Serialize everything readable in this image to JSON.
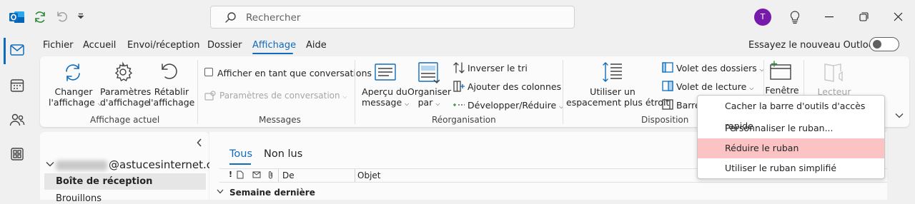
{
  "titlebar": {
    "search_placeholder": "Rechercher",
    "avatar_initial": "T"
  },
  "menu": {
    "tabs": [
      "Fichier",
      "Accueil",
      "Envoi/réception",
      "Dossier",
      "Affichage",
      "Aide"
    ],
    "active_tab": "Affichage",
    "new_outlook_label": "Essayez le nouveau Outlook"
  },
  "ribbon": {
    "affichage_actuel": {
      "group_label": "Affichage actuel",
      "changer": [
        "Changer",
        "l'affichage"
      ],
      "parametres": [
        "Paramètres",
        "d'affichage"
      ],
      "retablir": [
        "Rétablir",
        "l'affichage"
      ]
    },
    "messages": {
      "group_label": "Messages",
      "afficher_conversations": "Afficher en tant que conversations",
      "parametres_conversation": "Paramètres de conversation"
    },
    "reorganisation": {
      "group_label": "Réorganisation",
      "apercu": [
        "Aperçu du",
        "message"
      ],
      "organiser": [
        "Organiser",
        "par"
      ],
      "inverser": "Inverser le tri",
      "ajouter": "Ajouter des colonnes",
      "developper": "Développer/Réduire"
    },
    "disposition": {
      "group_label": "Disposition",
      "utiliser": [
        "Utiliser un",
        "espacement plus étroit"
      ],
      "volet_dossiers": "Volet des dossiers",
      "volet_lecture": "Volet de lecture",
      "barre": "Barre",
      "fenetre": "Fenêtre",
      "lecteur": "Lecteur"
    }
  },
  "context_menu": {
    "items": [
      "Cacher la barre d'outils d'accès rapide",
      "Personnaliser le ruban...",
      "Réduire le ruban",
      "Utiliser le ruban simplifié"
    ],
    "highlighted_index": 2,
    "highlight_color": "#fbc3c3"
  },
  "folders": {
    "account_suffix": "@astucesinternet.com",
    "inbox": "Boîte de réception",
    "drafts": "Brouillons"
  },
  "mail": {
    "tabs": [
      "Tous",
      "Non lus"
    ],
    "columns": {
      "from": "De",
      "subject": "Objet"
    },
    "group_header": "Semaine dernière"
  },
  "colors": {
    "accent": "#0f6cbd",
    "avatar": "#7719aa",
    "outlook_blue": "#0f6cbd"
  }
}
